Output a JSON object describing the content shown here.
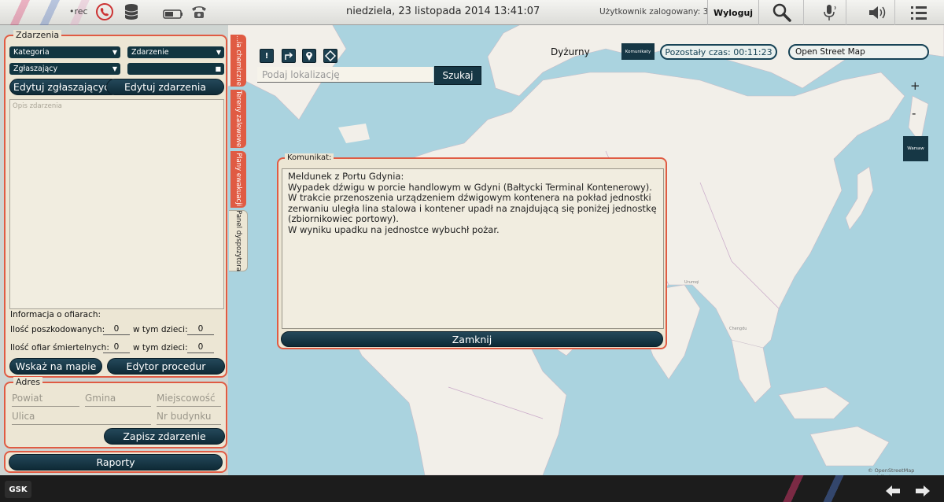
{
  "topbar": {
    "rec_label": "•rec",
    "datetime": "niedziela, 23 listopada 2014 13:41:07",
    "user_status": "Użytkownik zalogowany: 3",
    "logout_label": "Wyloguj",
    "icons": [
      "phone-icon",
      "database-icon",
      "battery-icon",
      "landline-phone-icon",
      "search-icon",
      "microphone-icon",
      "speaker-icon",
      "menu-icon"
    ]
  },
  "side_tabs": [
    "...ia chemiczne",
    "Tereny zalewowe",
    "Plany ewakuacji",
    "Panel dyspozytora"
  ],
  "zdarzenia": {
    "legend": "Zdarzenia",
    "kategoria": "Kategoria",
    "zdarzenie": "Zdarzenie",
    "zglaszajacy": "Zgłaszający",
    "edit_reporters_label": "Edytuj zgłaszających",
    "edit_incidents_label": "Edytuj zdarzenia",
    "description_placeholder": "Opis zdarzenia",
    "victims_heading": "Informacja o ofiarach:",
    "injured_label": "Ilość poszkodowanych:",
    "injured_value": "0",
    "injured_children_label": "w tym dzieci:",
    "injured_children_value": "0",
    "deaths_label": "Ilość ofiar śmiertelnych:",
    "deaths_value": "0",
    "deaths_children_label": "w tym dzieci:",
    "deaths_children_value": "0",
    "show_on_map_label": "Wskaż na mapie",
    "procedure_editor_label": "Edytor procedur"
  },
  "adres": {
    "legend": "Adres",
    "powiat": "Powiat",
    "gmina": "Gmina",
    "miejscowosc": "Miejscowość",
    "ulica": "Ulica",
    "nr_budynku": "Nr budynku",
    "save_label": "Zapisz zdarzenie"
  },
  "raporty_label": "Raporty",
  "map": {
    "search_placeholder": "Podaj lokalizację",
    "search_button": "Szukaj",
    "dyzurny": "Dyżurny",
    "komunikaty_button": "Komunikaty",
    "remaining_time": "Pozostały czas: 00:11:23",
    "layer": "Open Street Map",
    "zoom_in": "+",
    "zoom_out": "-",
    "warsaw_button": "Warsaw",
    "attribution": "© OpenStreetMap contributors",
    "place_labels": [
      "Urumqi",
      "Chengdu"
    ]
  },
  "modal": {
    "legend": "Komunikat:",
    "message": "Meldunek z Portu Gdynia:\nWypadek dźwigu w porcie handlowym w Gdyni (Bałtycki Terminal Kontenerowy).\nW trakcie przenoszenia urządzeniem dźwigowym kontenera na pokład jednostki\nzerwaniu uległa lina stalowa i kontener upadł na znajdującą się poniżej jednostkę\n(zbiornikowiec portowy).\nW wyniku upadku na jednostce wybuchł pożar.",
    "close_label": "Zamknij"
  },
  "bottom": {
    "gsk_label": "GSK"
  },
  "colors": {
    "accent": "#e05b43",
    "button_dark": "#163745",
    "sea": "#aad3df",
    "land": "#f2efe9"
  }
}
